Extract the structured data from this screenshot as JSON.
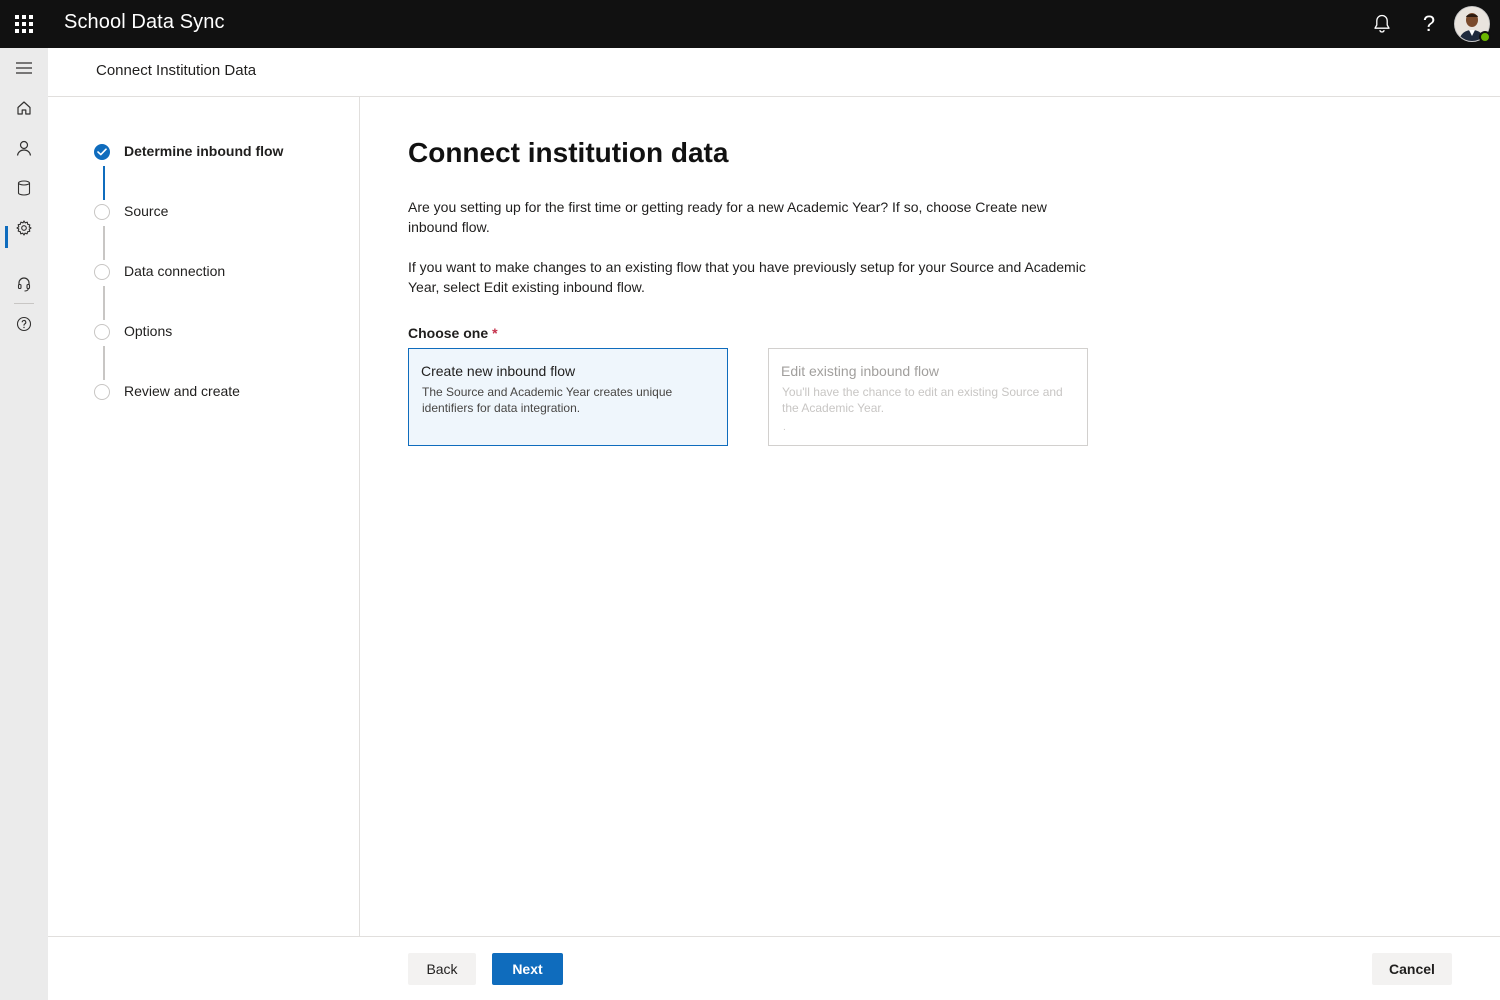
{
  "app": {
    "title": "School Data Sync",
    "waffle_icon": "app-launcher-icon",
    "notifications_icon": "bell-icon",
    "help_icon": "help-icon",
    "help_glyph": "?",
    "avatar_icon": "user-avatar",
    "presence_color": "#6bb700"
  },
  "rail": {
    "items": [
      {
        "name": "menu-icon"
      },
      {
        "name": "home-icon"
      },
      {
        "name": "people-icon"
      },
      {
        "name": "database-icon",
        "active": true
      },
      {
        "name": "gear-icon"
      },
      {
        "name": "headset-icon"
      },
      {
        "name": "question-circle-icon"
      }
    ],
    "active_color": "#0f6cbd"
  },
  "header": {
    "title": "Connect Institution Data"
  },
  "steps": [
    {
      "label": "Determine inbound flow",
      "state": "completed"
    },
    {
      "label": "Source",
      "state": "pending"
    },
    {
      "label": "Data connection",
      "state": "pending"
    },
    {
      "label": "Options",
      "state": "pending"
    },
    {
      "label": "Review and create",
      "state": "pending"
    }
  ],
  "main": {
    "heading": "Connect institution data",
    "paragraph1": "Are you setting up for the first time or getting ready for a new Academic Year? If so, choose Create new inbound flow.",
    "paragraph2": "If you want to make changes to an existing flow that you have previously setup for your Source and Academic Year, select Edit existing inbound flow.",
    "choose_label": "Choose one",
    "required_marker": "*",
    "options": [
      {
        "title": "Create new inbound flow",
        "description": "The Source and Academic Year creates unique identifiers for data integration.",
        "selected": true,
        "enabled": true
      },
      {
        "title": "Edit existing inbound flow",
        "description": "You'll have the chance to edit an existing Source and the Academic Year.",
        "trailing": ".",
        "selected": false,
        "enabled": false
      }
    ]
  },
  "footer": {
    "back_label": "Back",
    "next_label": "Next",
    "cancel_label": "Cancel"
  },
  "colors": {
    "accent": "#0f6cbd",
    "topbar": "#111111",
    "rail_bg": "#ebebeb",
    "selected_card_bg": "#eff6fc",
    "required": "#c4314b"
  }
}
